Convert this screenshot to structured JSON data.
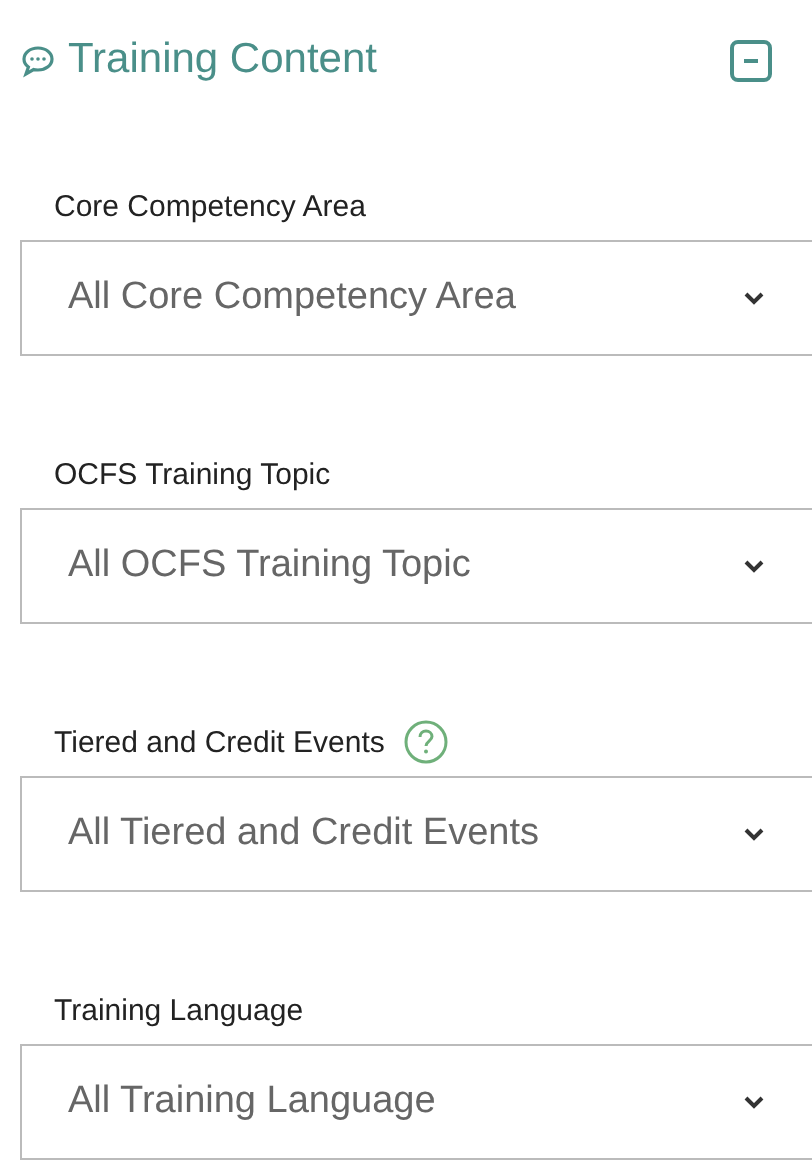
{
  "section": {
    "title": "Training Content",
    "expanded": true
  },
  "filters": [
    {
      "label": "Core Competency Area",
      "value": "All Core Competency Area",
      "help": false
    },
    {
      "label": "OCFS Training Topic",
      "value": "All OCFS Training Topic",
      "help": false
    },
    {
      "label": "Tiered and Credit Events",
      "value": "All Tiered and Credit Events",
      "help": true
    },
    {
      "label": "Training Language",
      "value": "All Training Language",
      "help": false
    }
  ]
}
